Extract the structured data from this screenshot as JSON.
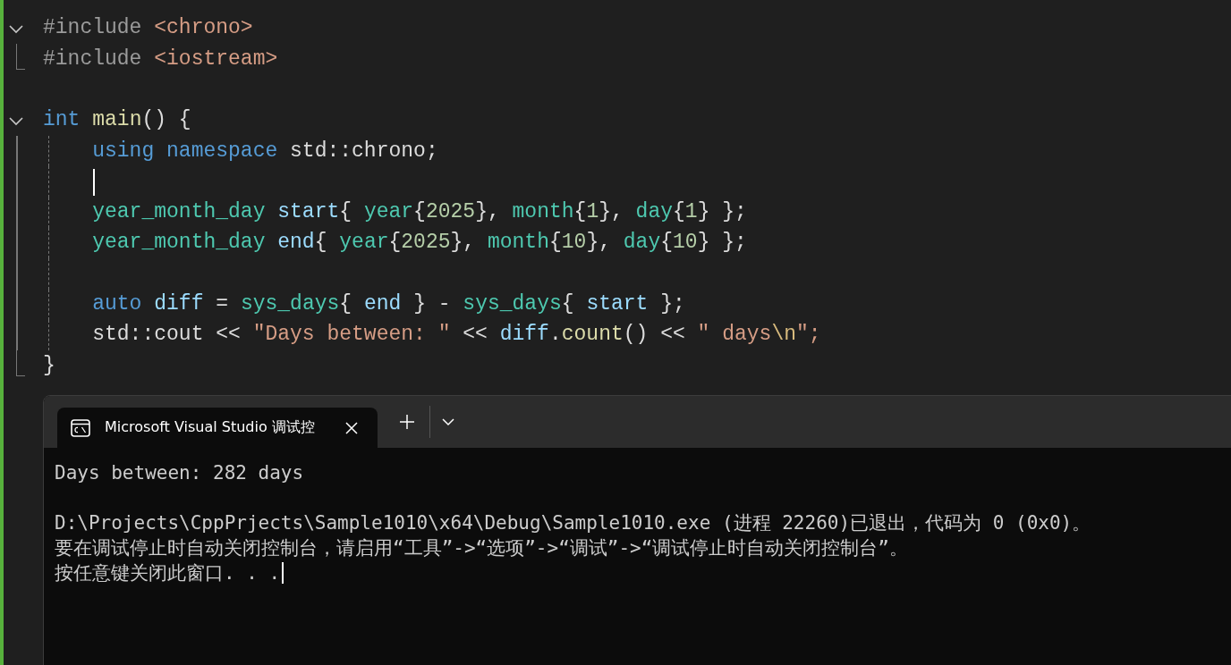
{
  "editor": {
    "lines": [
      {
        "kind": "fold_start",
        "tokens": [
          {
            "text": "#include ",
            "kind": "preproc"
          },
          {
            "text": "<chrono>",
            "kind": "string"
          }
        ]
      },
      {
        "kind": "fold_end",
        "tokens": [
          {
            "text": "#include ",
            "kind": "preproc"
          },
          {
            "text": "<iostream>",
            "kind": "string"
          }
        ]
      },
      {
        "kind": "blank"
      },
      {
        "kind": "fold_start",
        "tokens": [
          {
            "text": "int ",
            "kind": "keyword"
          },
          {
            "text": "main",
            "kind": "function"
          },
          {
            "text": "() {",
            "kind": "plain"
          }
        ]
      },
      {
        "kind": "body",
        "tokens": [
          {
            "text": "    using namespace",
            "kind": "keyword"
          },
          {
            "text": " std::chrono;",
            "kind": "plain"
          }
        ]
      },
      {
        "kind": "body",
        "cursor": true
      },
      {
        "kind": "body",
        "tokens": [
          {
            "text": "    year_month_day ",
            "kind": "type"
          },
          {
            "text": "start",
            "kind": "variable"
          },
          {
            "text": "{ ",
            "kind": "plain"
          },
          {
            "text": "year",
            "kind": "type"
          },
          {
            "text": "{",
            "kind": "plain"
          },
          {
            "text": "2025",
            "kind": "number"
          },
          {
            "text": "}, ",
            "kind": "plain"
          },
          {
            "text": "month",
            "kind": "type"
          },
          {
            "text": "{",
            "kind": "plain"
          },
          {
            "text": "1",
            "kind": "number"
          },
          {
            "text": "}, ",
            "kind": "plain"
          },
          {
            "text": "day",
            "kind": "type"
          },
          {
            "text": "{",
            "kind": "plain"
          },
          {
            "text": "1",
            "kind": "number"
          },
          {
            "text": "} };",
            "kind": "plain"
          }
        ]
      },
      {
        "kind": "body",
        "tokens": [
          {
            "text": "    year_month_day ",
            "kind": "type"
          },
          {
            "text": "end",
            "kind": "variable"
          },
          {
            "text": "{ ",
            "kind": "plain"
          },
          {
            "text": "year",
            "kind": "type"
          },
          {
            "text": "{",
            "kind": "plain"
          },
          {
            "text": "2025",
            "kind": "number"
          },
          {
            "text": "}, ",
            "kind": "plain"
          },
          {
            "text": "month",
            "kind": "type"
          },
          {
            "text": "{",
            "kind": "plain"
          },
          {
            "text": "10",
            "kind": "number"
          },
          {
            "text": "}, ",
            "kind": "plain"
          },
          {
            "text": "day",
            "kind": "type"
          },
          {
            "text": "{",
            "kind": "plain"
          },
          {
            "text": "10",
            "kind": "number"
          },
          {
            "text": "} };",
            "kind": "plain"
          }
        ]
      },
      {
        "kind": "body"
      },
      {
        "kind": "body",
        "tokens": [
          {
            "text": "    auto ",
            "kind": "keyword"
          },
          {
            "text": "diff",
            "kind": "variable"
          },
          {
            "text": " = ",
            "kind": "plain"
          },
          {
            "text": "sys_days",
            "kind": "type"
          },
          {
            "text": "{ ",
            "kind": "plain"
          },
          {
            "text": "end",
            "kind": "variable"
          },
          {
            "text": " } - ",
            "kind": "plain"
          },
          {
            "text": "sys_days",
            "kind": "type"
          },
          {
            "text": "{ ",
            "kind": "plain"
          },
          {
            "text": "start",
            "kind": "variable"
          },
          {
            "text": " };",
            "kind": "plain"
          }
        ]
      },
      {
        "kind": "body",
        "tokens": [
          {
            "text": "    std::cout << ",
            "kind": "plain"
          },
          {
            "text": "\"Days between: \"",
            "kind": "string"
          },
          {
            "text": " << ",
            "kind": "plain"
          },
          {
            "text": "diff",
            "kind": "variable"
          },
          {
            "text": ".",
            "kind": "plain"
          },
          {
            "text": "count",
            "kind": "function"
          },
          {
            "text": "() << ",
            "kind": "plain"
          },
          {
            "text": "\" days",
            "kind": "string"
          },
          {
            "text": "\\n",
            "kind": "escape"
          },
          {
            "text": "\";",
            "kind": "string"
          }
        ]
      },
      {
        "kind": "fold_end",
        "tokens": [
          {
            "text": "}",
            "kind": "plain"
          }
        ]
      }
    ]
  },
  "terminal": {
    "tab_title": "Microsoft Visual Studio 调试控",
    "cursor": true,
    "output_blocks": [
      {
        "lines": [
          "Days between: 282 days"
        ]
      },
      {
        "lines": [
          "D:\\Projects\\CppPrjects\\Sample1010\\x64\\Debug\\Sample1010.exe (进程 22260)已退出，代码为 0 (0x0)。",
          "要在调试停止时自动关闭控制台，请启用“工具”->“选项”->“调试”->“调试停止时自动关闭控制台”。",
          "按任意键关闭此窗口. . ."
        ]
      }
    ]
  }
}
